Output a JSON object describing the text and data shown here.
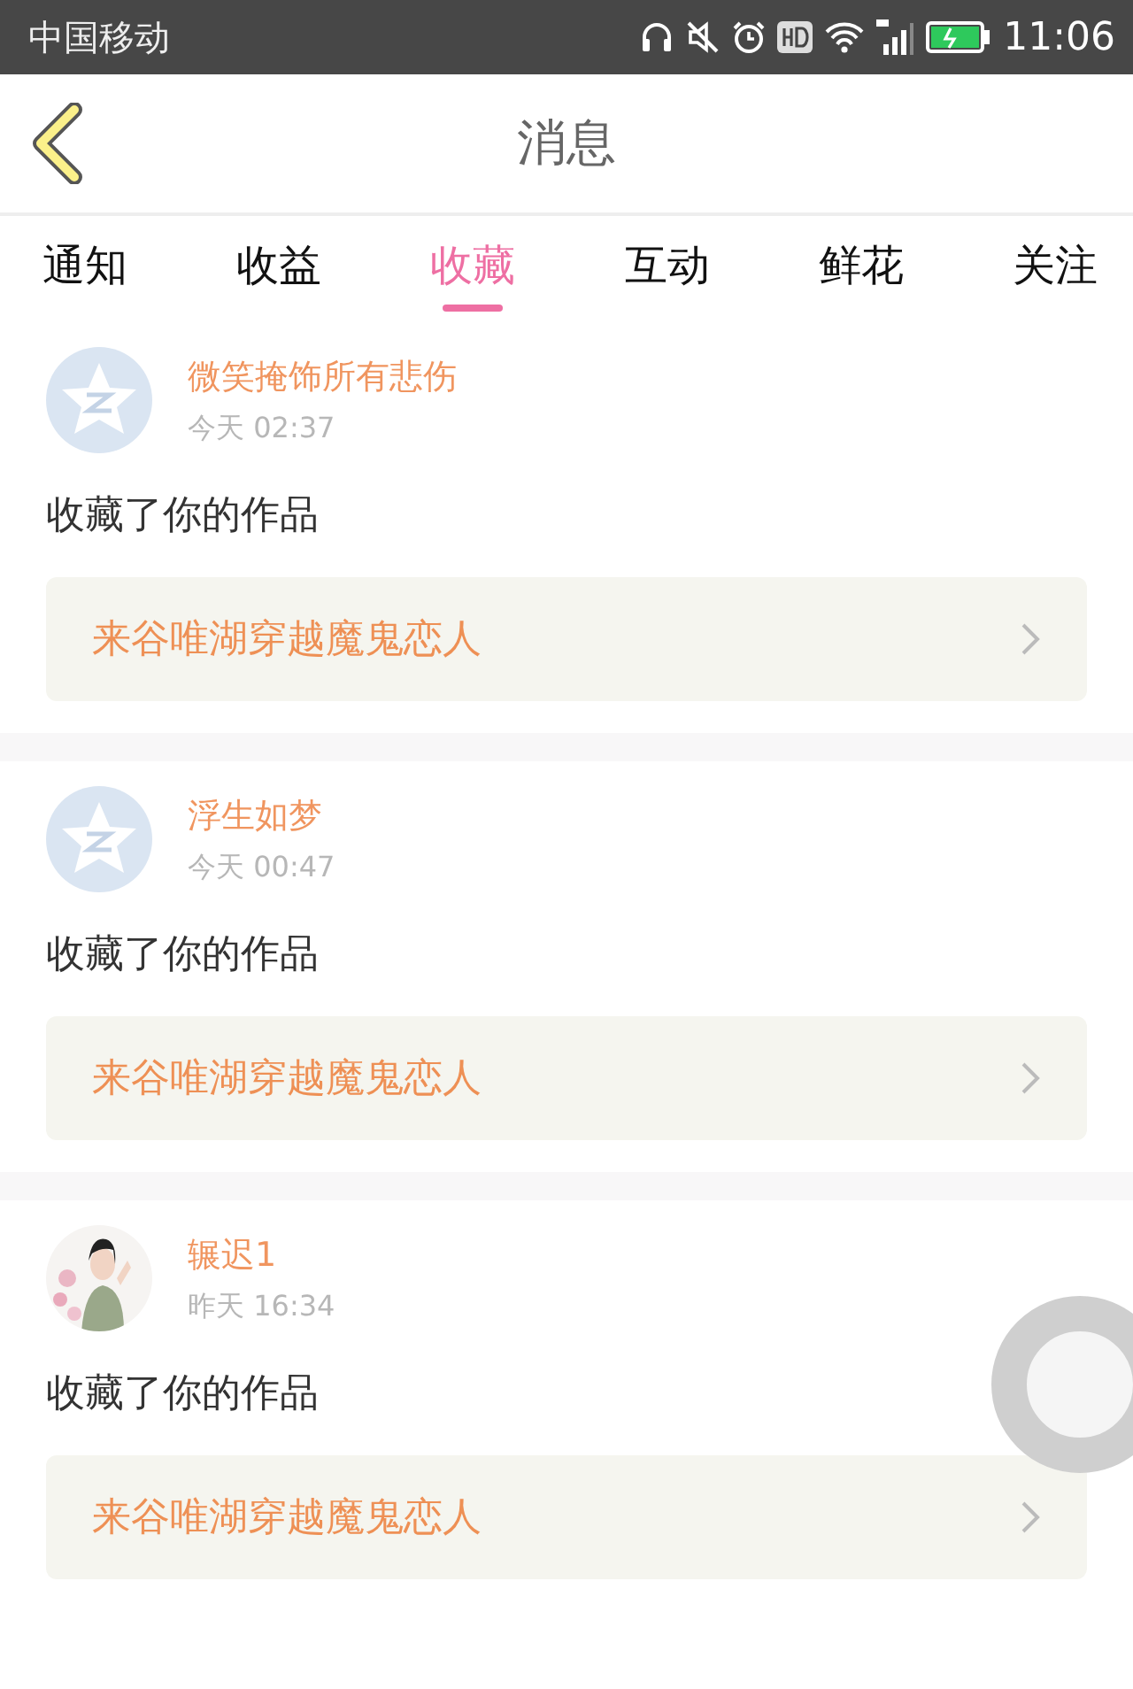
{
  "status_bar": {
    "carrier": "中国移动",
    "time": "11:06"
  },
  "header": {
    "title": "消息"
  },
  "tabs": [
    {
      "label": "通知",
      "selected": false
    },
    {
      "label": "收益",
      "selected": false
    },
    {
      "label": "收藏",
      "selected": true
    },
    {
      "label": "互动",
      "selected": false
    },
    {
      "label": "鲜花",
      "selected": false
    },
    {
      "label": "关注",
      "selected": false
    }
  ],
  "messages": [
    {
      "avatar": {
        "kind": "default"
      },
      "name": "微笑掩饰所有悲伤",
      "time": "今天 02:37",
      "text": "收藏了你的作品",
      "work": "来谷唯湖穿越魔鬼恋人"
    },
    {
      "avatar": {
        "kind": "default"
      },
      "name": "浮生如梦",
      "time": "今天 00:47",
      "text": "收藏了你的作品",
      "work": "来谷唯湖穿越魔鬼恋人"
    },
    {
      "name": "辗迟1",
      "time": "昨天 16:34",
      "text": "收藏了你的作品",
      "work": "来谷唯湖穿越魔鬼恋人"
    }
  ]
}
